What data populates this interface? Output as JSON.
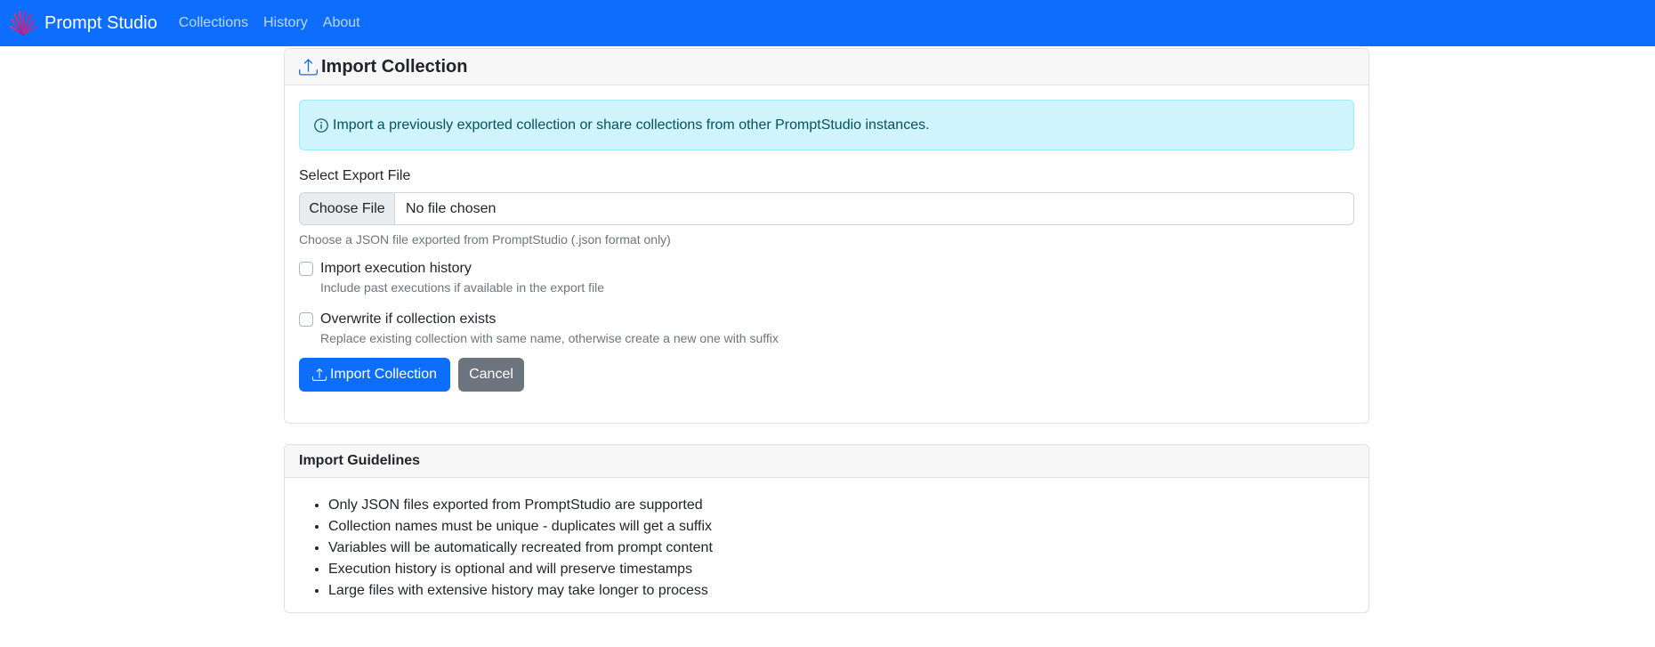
{
  "navbar": {
    "brand": "Prompt Studio",
    "links": [
      "Collections",
      "History",
      "About"
    ],
    "background": "#0d6efd"
  },
  "import_card": {
    "title": "Import Collection",
    "icon": "upload-icon",
    "alert_text": "Import a previously exported collection or share collections from other PromptStudio instances.",
    "file_label": "Select Export File",
    "choose_button": "Choose File",
    "file_status": "No file chosen",
    "file_help": "Choose a JSON file exported from PromptStudio (.json format only)",
    "options": [
      {
        "label": "Import execution history",
        "help": "Include past executions if available in the export file",
        "checked": false
      },
      {
        "label": "Overwrite if collection exists",
        "help": "Replace existing collection with same name, otherwise create a new one with suffix",
        "checked": false
      }
    ],
    "submit_button": "Import Collection",
    "cancel_button": "Cancel"
  },
  "guidelines": {
    "title": "Import Guidelines",
    "items": [
      "Only JSON files exported from PromptStudio are supported",
      "Collection names must be unique - duplicates will get a suffix",
      "Variables will be automatically recreated from prompt content",
      "Execution history is optional and will preserve timestamps",
      "Large files with extensive history may take longer to process"
    ]
  }
}
